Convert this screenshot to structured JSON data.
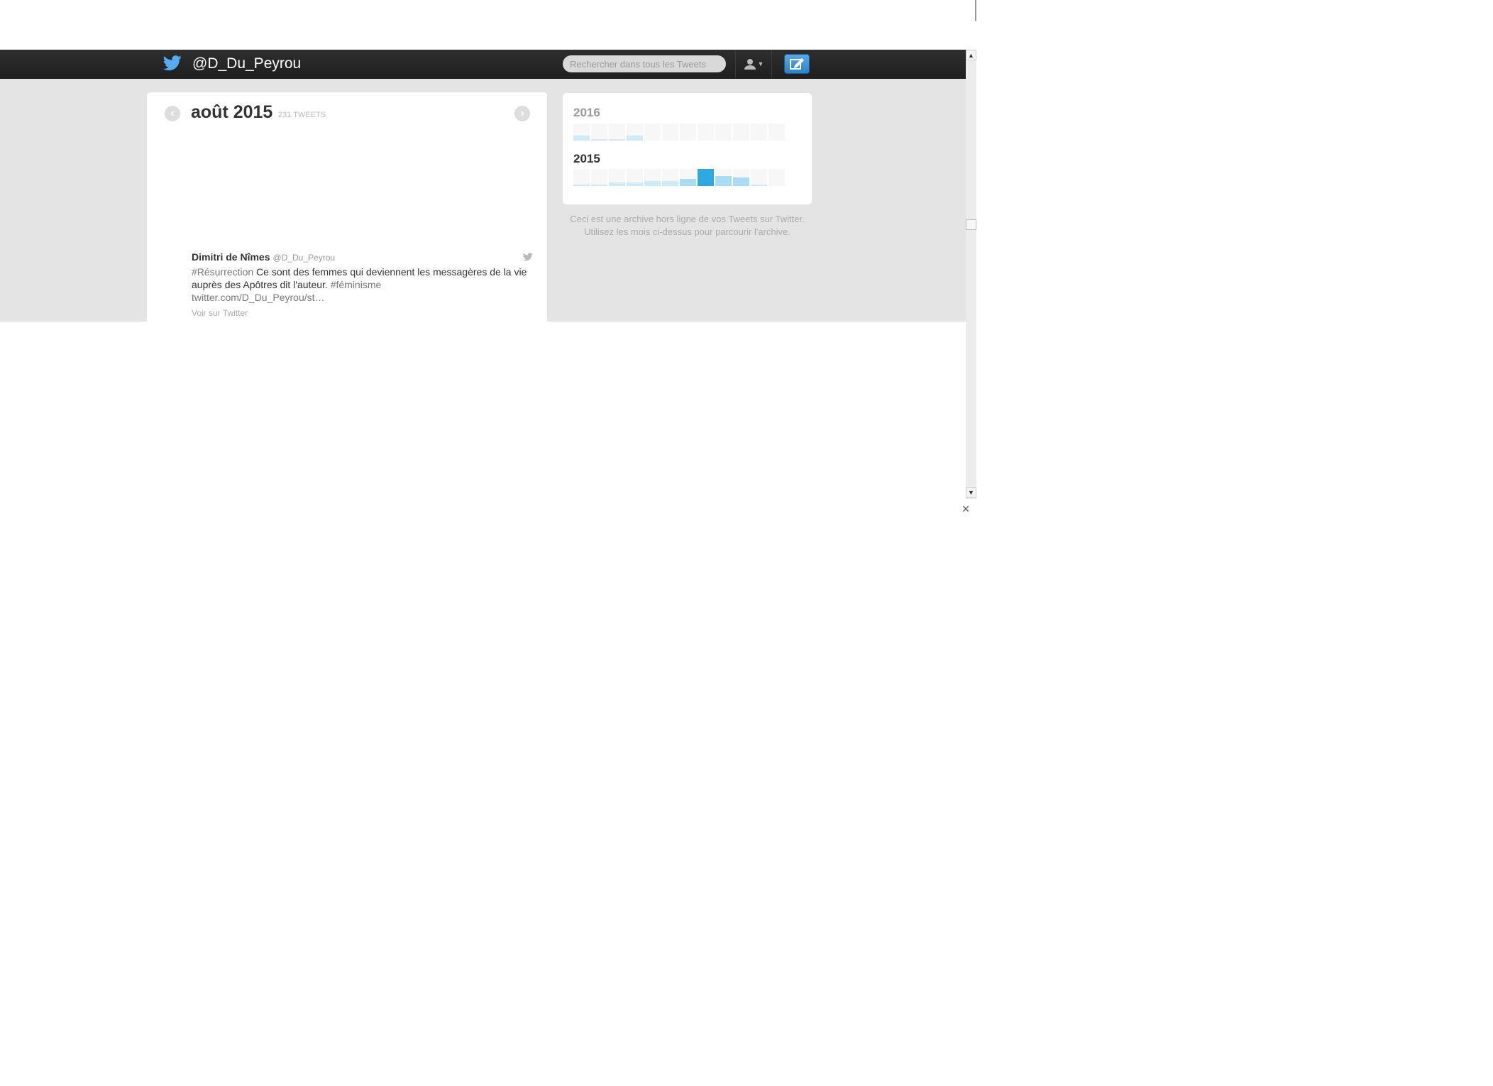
{
  "header": {
    "handle": "@D_Du_Peyrou",
    "search_placeholder": "Rechercher dans tous les Tweets",
    "icons": [
      "twitter-bird-icon",
      "user-icon",
      "compose-icon"
    ],
    "colors": {
      "bar": "#262626",
      "bird": "#55acee",
      "compose": "#3d8fd4"
    }
  },
  "month_view": {
    "title": "août 2015",
    "tweet_count": "231 TWEETS",
    "prev_icon": "‹",
    "next_icon": "›"
  },
  "tweet": {
    "name": "Dimitri de Nîmes",
    "screen_name": "@D_Du_Peyrou",
    "hashtag1": "#Résurrection",
    "text": " Ce sont des femmes qui deviennent les messagères de la vie auprès des Apôtres dit l'auteur. ",
    "hashtag2": "#féminisme",
    "link": "twitter.com/D_Du_Peyrou/st…",
    "view_label": "Voir sur Twitter"
  },
  "archive": {
    "years": [
      {
        "year": "2016",
        "months": [
          0.3,
          0.1,
          0.1,
          0.3,
          0,
          0,
          0,
          0,
          0,
          0,
          0,
          0
        ],
        "selected": -1
      },
      {
        "year": "2015",
        "months": [
          0.1,
          0.1,
          0.2,
          0.2,
          0.3,
          0.3,
          0.4,
          1.0,
          0.6,
          0.5,
          0.1,
          0
        ],
        "selected": 7
      }
    ],
    "colors": {
      "light": "#cfeaf7",
      "medium": "#a9dcf2",
      "selected": "#2fa8e0",
      "empty": "#f7f7f7"
    }
  },
  "archive_note": {
    "line1": "Ceci est une archive hors ligne de vos Tweets sur Twitter.",
    "line2": "Utilisez les mois ci-dessus pour parcourir l'archive."
  },
  "scrollbar": {
    "up": "▲",
    "down": "▼"
  },
  "close_label": "×"
}
